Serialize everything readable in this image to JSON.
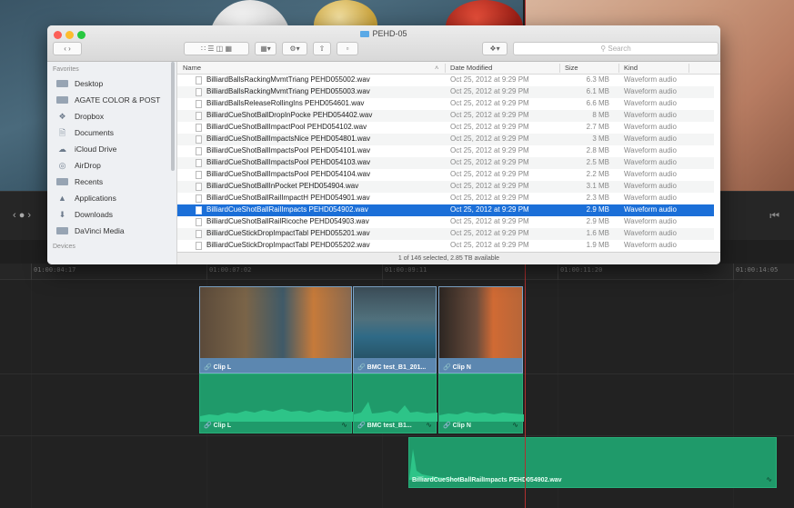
{
  "finder": {
    "title": "PEHD-05",
    "search_placeholder": "Search",
    "sidebar": {
      "heading": "Favorites",
      "items": [
        "Desktop",
        "AGATE COLOR & POST",
        "Dropbox",
        "Documents",
        "iCloud Drive",
        "AirDrop",
        "Recents",
        "Applications",
        "Downloads",
        "DaVinci Media"
      ],
      "heading2": "Devices"
    },
    "columns": [
      "Name",
      "Date Modified",
      "Size",
      "Kind"
    ],
    "selected_index": 11,
    "files": [
      {
        "name": "BilliardBallsRackingMvmtTriang PEHD055002.wav",
        "date": "Oct 25, 2012 at 9:29 PM",
        "size": "6.3 MB",
        "kind": "Waveform audio"
      },
      {
        "name": "BilliardBallsRackingMvmtTriang PEHD055003.wav",
        "date": "Oct 25, 2012 at 9:29 PM",
        "size": "6.1 MB",
        "kind": "Waveform audio"
      },
      {
        "name": "BilliardBallsReleaseRollingIns PEHD054601.wav",
        "date": "Oct 25, 2012 at 9:29 PM",
        "size": "6.6 MB",
        "kind": "Waveform audio"
      },
      {
        "name": "BilliardCueShotBallDropInPocke PEHD054402.wav",
        "date": "Oct 25, 2012 at 9:29 PM",
        "size": "8 MB",
        "kind": "Waveform audio"
      },
      {
        "name": "BilliardCueShotBallImpactPool PEHD054102.wav",
        "date": "Oct 25, 2012 at 9:29 PM",
        "size": "2.7 MB",
        "kind": "Waveform audio"
      },
      {
        "name": "BilliardCueShotBallImpactsNice PEHD054801.wav",
        "date": "Oct 25, 2012 at 9:29 PM",
        "size": "3 MB",
        "kind": "Waveform audio"
      },
      {
        "name": "BilliardCueShotBallImpactsPool PEHD054101.wav",
        "date": "Oct 25, 2012 at 9:29 PM",
        "size": "2.8 MB",
        "kind": "Waveform audio"
      },
      {
        "name": "BilliardCueShotBallImpactsPool PEHD054103.wav",
        "date": "Oct 25, 2012 at 9:29 PM",
        "size": "2.5 MB",
        "kind": "Waveform audio"
      },
      {
        "name": "BilliardCueShotBallImpactsPool PEHD054104.wav",
        "date": "Oct 25, 2012 at 9:29 PM",
        "size": "2.2 MB",
        "kind": "Waveform audio"
      },
      {
        "name": "BilliardCueShotBallInPocket PEHD054904.wav",
        "date": "Oct 25, 2012 at 9:29 PM",
        "size": "3.1 MB",
        "kind": "Waveform audio"
      },
      {
        "name": "BilliardCueShotBallRailImpactH PEHD054901.wav",
        "date": "Oct 25, 2012 at 9:29 PM",
        "size": "2.3 MB",
        "kind": "Waveform audio"
      },
      {
        "name": "BilliardCueShotBallRailImpacts PEHD054902.wav",
        "date": "Oct 25, 2012 at 9:29 PM",
        "size": "2.9 MB",
        "kind": "Waveform audio"
      },
      {
        "name": "BilliardCueShotBallRailRicoche PEHD054903.wav",
        "date": "Oct 25, 2012 at 9:29 PM",
        "size": "2.9 MB",
        "kind": "Waveform audio"
      },
      {
        "name": "BilliardCueStickDropImpactTabl PEHD055201.wav",
        "date": "Oct 25, 2012 at 9:29 PM",
        "size": "1.6 MB",
        "kind": "Waveform audio"
      },
      {
        "name": "BilliardCueStickDropImpactTabl PEHD055202.wav",
        "date": "Oct 25, 2012 at 9:29 PM",
        "size": "1.9 MB",
        "kind": "Waveform audio"
      }
    ],
    "status": "1 of 146 selected, 2.85 TB available"
  },
  "timeline": {
    "ruler": [
      "01:00:04:17",
      "01:00:07:02",
      "01:00:09:11",
      "01:00:11:20",
      "01:00:14:05"
    ],
    "video_clips": [
      "Clip L",
      "BMC test_B1_201...",
      "Clip N"
    ],
    "audio_clips": [
      "Clip L",
      "BMC test_B1...",
      "Clip N"
    ],
    "sfx_clip": "BilliardCueShotBallRailImpacts PEHD054902.wav"
  }
}
